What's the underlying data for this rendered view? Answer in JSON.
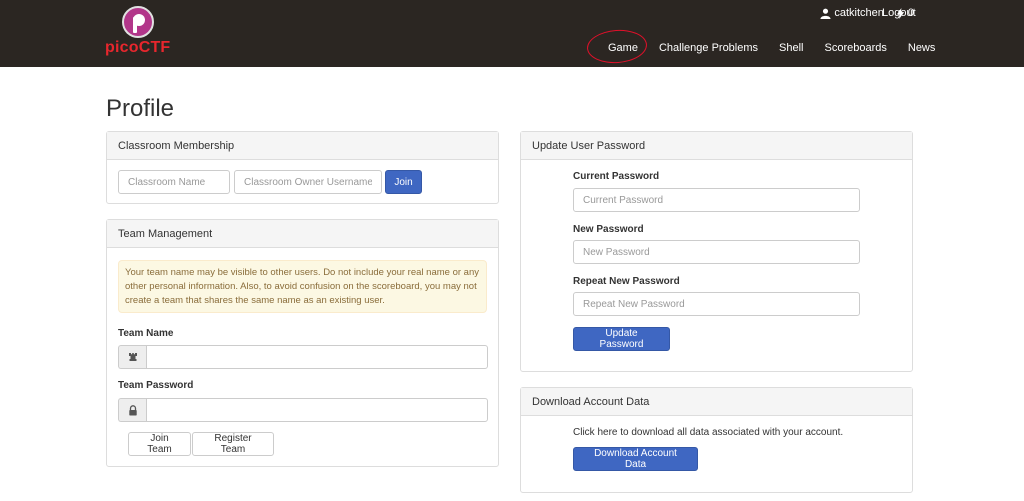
{
  "brand": {
    "name": "picoCTF"
  },
  "user": {
    "username": "catkitchen",
    "score": "0",
    "logout_label": "Logout"
  },
  "nav": {
    "items": [
      {
        "label": "Game"
      },
      {
        "label": "Challenge Problems"
      },
      {
        "label": "Shell"
      },
      {
        "label": "Scoreboards"
      },
      {
        "label": "News"
      }
    ]
  },
  "page": {
    "title": "Profile"
  },
  "classroom": {
    "heading": "Classroom Membership",
    "name_placeholder": "Classroom Name",
    "owner_placeholder": "Classroom Owner Username",
    "join_label": "Join"
  },
  "team": {
    "heading": "Team Management",
    "warning": "Your team name may be visible to other users. Do not include your real name or any other personal information. Also, to avoid confusion on the scoreboard, you may not create a team that shares the same name as an existing user.",
    "name_label": "Team Name",
    "name_value": "",
    "password_label": "Team Password",
    "password_value": "",
    "join_label": "Join Team",
    "register_label": "Register Team"
  },
  "password": {
    "heading": "Update User Password",
    "current_label": "Current Password",
    "current_placeholder": "Current Password",
    "new_label": "New Password",
    "new_placeholder": "New Password",
    "repeat_label": "Repeat New Password",
    "repeat_placeholder": "Repeat New Password",
    "submit_label": "Update Password"
  },
  "download": {
    "heading": "Download Account Data",
    "text": "Click here to download all data associated with your account.",
    "button_label": "Download Account Data"
  },
  "colors": {
    "navbar": "#2b2622",
    "primary": "#3f67c2",
    "brand_red": "#e8262d",
    "annotation": "#e0102a"
  }
}
